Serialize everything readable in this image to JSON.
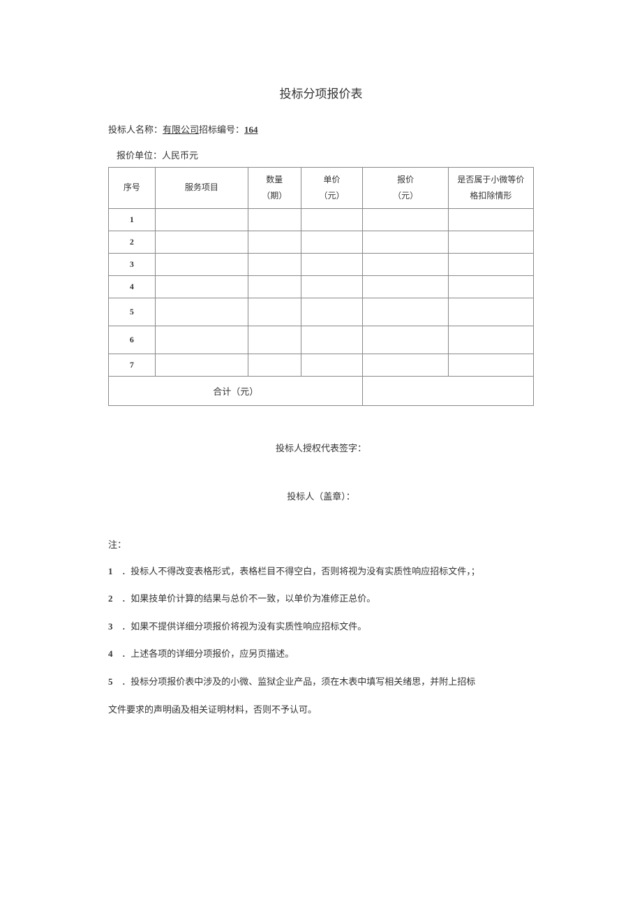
{
  "title": "投标分项报价表",
  "bidder": {
    "label": "投标人名称：",
    "company": "有限公司",
    "tender_label": "招标编号：",
    "tender_number": "164"
  },
  "unit_line": "报价单位：人民币元",
  "headers": {
    "seq": "序号",
    "item": "服务项目",
    "qty_line1": "数量",
    "qty_line2": "（期）",
    "unit_line1": "单价",
    "unit_line2": "（元）",
    "price_line1": "报价",
    "price_line2": "（元）",
    "micro_line1": "是否属于小微等价",
    "micro_line2": "格扣除情形"
  },
  "rows": [
    "1",
    "2",
    "3",
    "4",
    "5",
    "6",
    "7"
  ],
  "total_label": "合计（元）",
  "signature_label": "投标人授权代表签字：",
  "seal_label": "投标人（盖章）：",
  "notes_header": "注：",
  "notes": [
    {
      "num": "1",
      "text": "．投标人不得改变表格形式，表格栏目不得空白，否则将视为没有实质性响应招标文件，；"
    },
    {
      "num": "2",
      "text": "．如果技单价计算的结果与总价不一致，以单价为准修正总价。"
    },
    {
      "num": "3",
      "text": "．如果不提供详细分项报价将视为没有实质性响应招标文件。"
    },
    {
      "num": "4",
      "text": "．上述各项的详细分项报价，应另页描述。"
    },
    {
      "num": "5",
      "text": "．投标分项报价表中涉及的小微、监狱企业产品，须在木表中填写相关绪思，并附上招标"
    }
  ],
  "note_continuation": "文件要求的声明函及相关证明材料，否则不予认可。"
}
